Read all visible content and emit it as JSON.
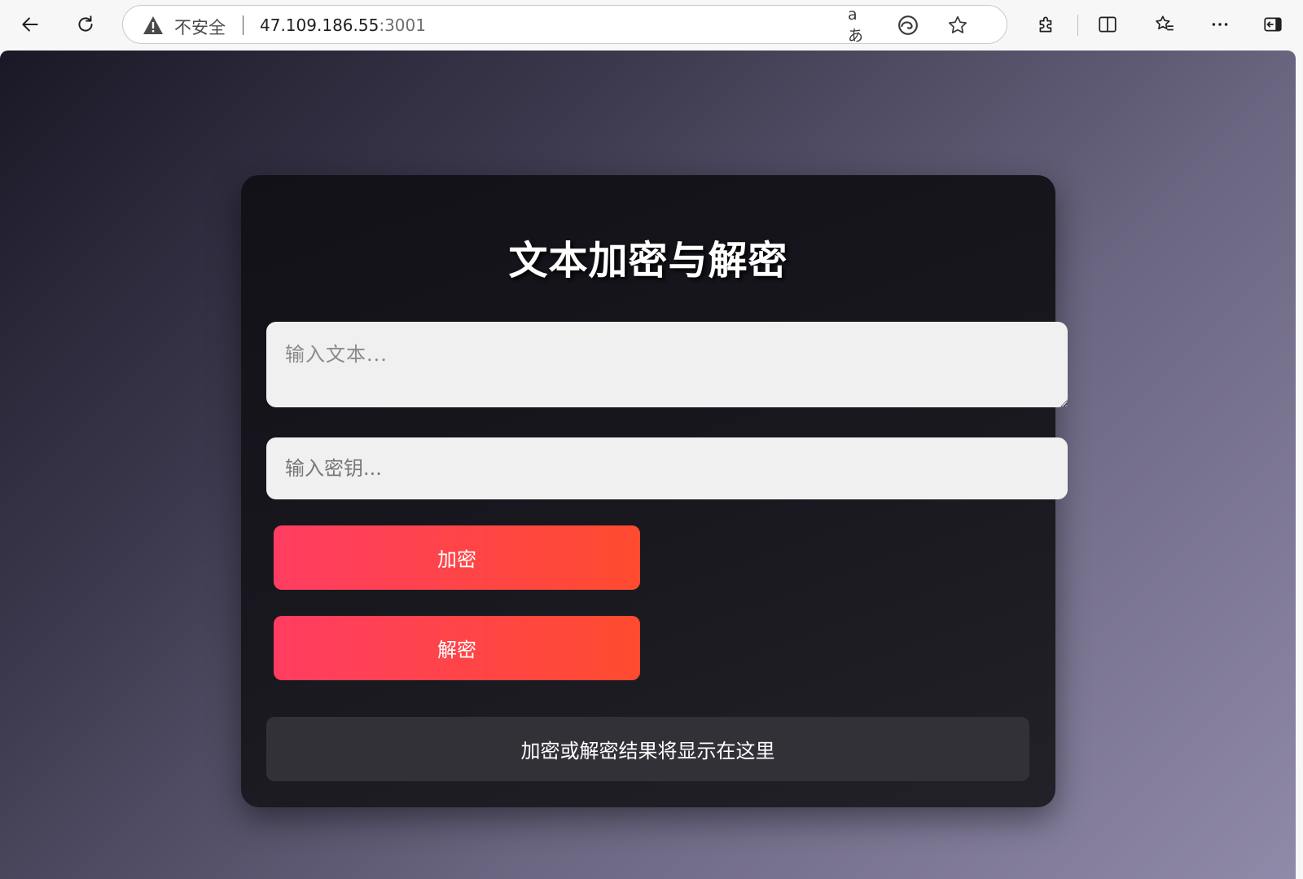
{
  "browser": {
    "security_label": "不安全",
    "url_host": "47.109.186.55",
    "url_port": ":3001",
    "read_aloud_icon_text": "aあ"
  },
  "page": {
    "title": "文本加密与解密",
    "text_input": {
      "placeholder": "输入文本...",
      "value": ""
    },
    "key_input": {
      "placeholder": "输入密钥...",
      "value": ""
    },
    "encrypt_label": "加密",
    "decrypt_label": "解密",
    "result_text": "加密或解密结果将显示在这里"
  },
  "colors": {
    "button_gradient_start": "#ff3d62",
    "button_gradient_end": "#ff4b2f",
    "card_background": "#18171e",
    "result_background": "#323138"
  }
}
